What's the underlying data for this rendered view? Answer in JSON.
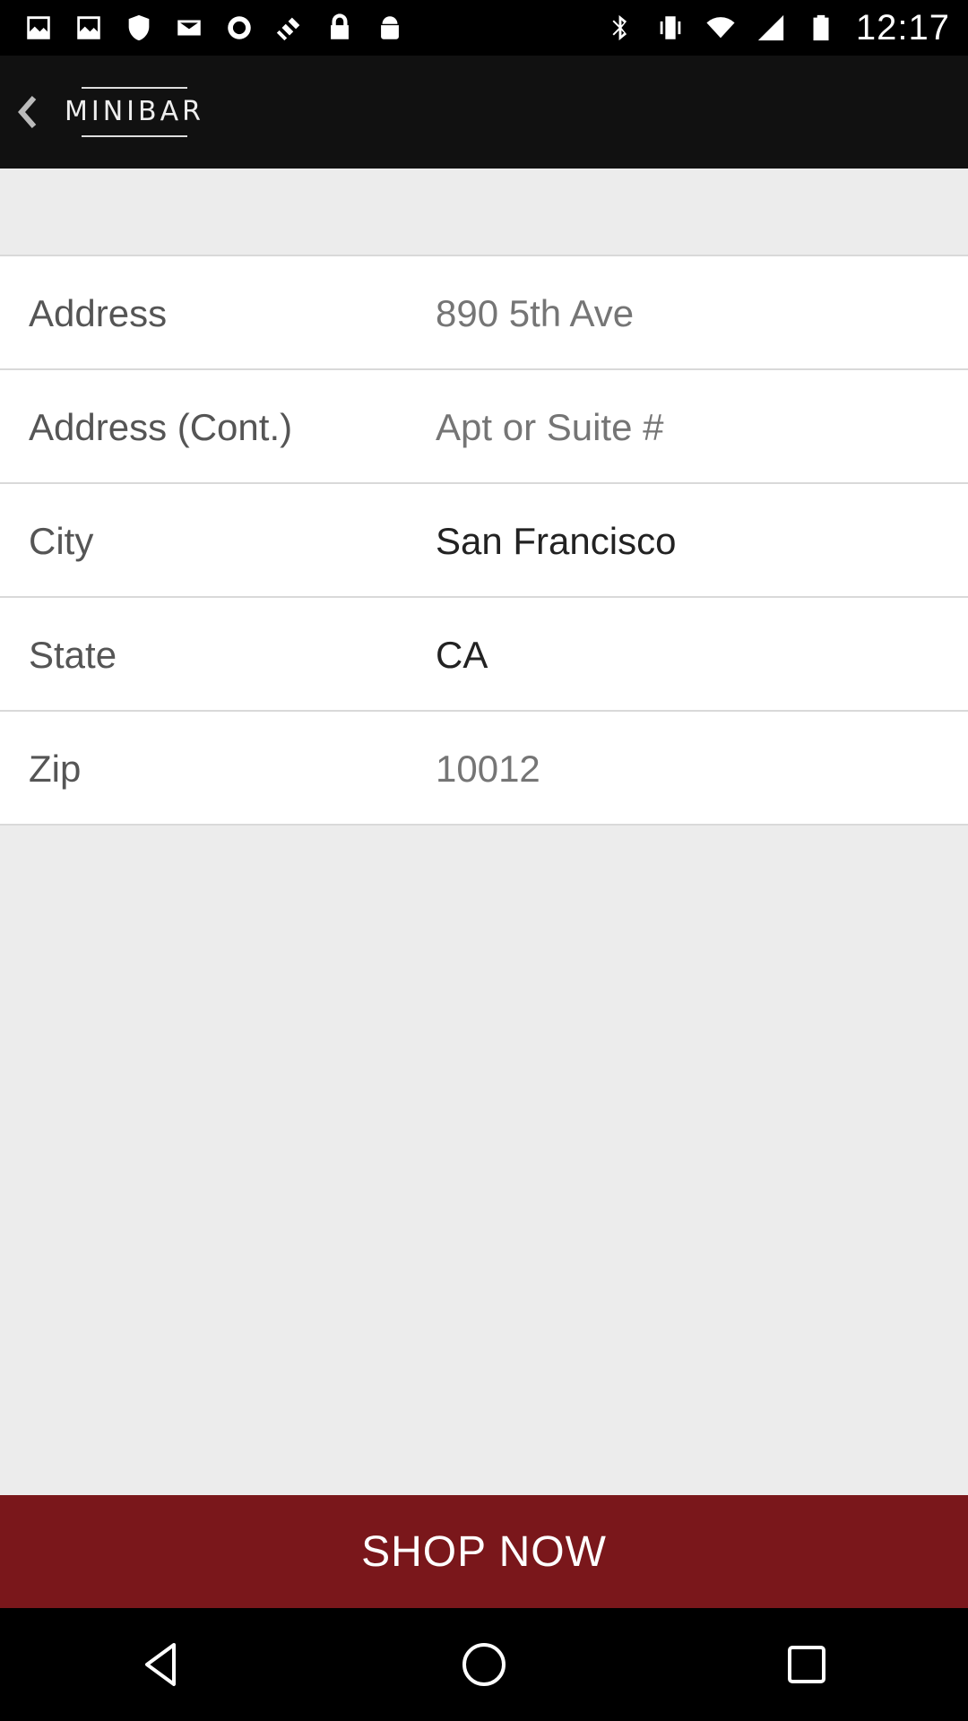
{
  "status_bar": {
    "time": "12:17",
    "left_icons": [
      "image-icon",
      "image-icon",
      "shield-icon",
      "mail-icon",
      "record-icon",
      "satellite-icon",
      "lock-icon",
      "android-icon"
    ],
    "right_icons": [
      "bluetooth-icon",
      "vibrate-icon",
      "wifi-icon",
      "signal-icon",
      "battery-icon"
    ]
  },
  "app_bar": {
    "logo_text": "MINIBAR"
  },
  "form": {
    "rows": [
      {
        "label": "Address",
        "placeholder": "890 5th Ave",
        "value": ""
      },
      {
        "label": "Address (Cont.)",
        "placeholder": "Apt or Suite #",
        "value": ""
      },
      {
        "label": "City",
        "placeholder": "",
        "value": "San Francisco"
      },
      {
        "label": "State",
        "placeholder": "",
        "value": "CA"
      },
      {
        "label": "Zip",
        "placeholder": "10012",
        "value": ""
      }
    ]
  },
  "shop_button": {
    "label": "SHOP NOW"
  },
  "colors": {
    "accent": "#7a171b",
    "app_bar": "#111111",
    "background": "#ececec"
  }
}
